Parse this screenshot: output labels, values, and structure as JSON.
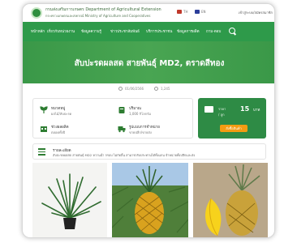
{
  "header": {
    "department_name": "กรมส่งเสริมการเกษตร Department of Agricultural Extension",
    "department_sub": "กระทรวงเกษตรและสหกรณ์ Ministry of Agriculture and Cooperatives",
    "lang_th": "TH",
    "lang_en": "EN",
    "login_label": "เข้าสู่ระบบ/สมัครสมาชิก"
  },
  "nav": {
    "items": [
      "หน้าหลัก",
      "เกี่ยวกับหน่วยงาน",
      "ข้อมูลความรู้",
      "ข่าวประชาสัมพันธ์",
      "บริการประชาชน",
      "ข้อมูลการผลิต",
      "ถาม-ตอบ"
    ]
  },
  "hero": {
    "title": "สับปะรดผลสด สายพันธุ์ MD2, ตราดสีทอง"
  },
  "meta": {
    "date": "01/06/2566",
    "views": "1,245"
  },
  "info": {
    "category_label": "หมวดหมู่",
    "category_value": "ผลไม้/สับปะรด",
    "stock_label": "ปริมาณ",
    "stock_value": "1,000 กิโลกรัม",
    "season_label": "ช่วงผลผลิต",
    "season_value": "ตลอดทั้งปี",
    "delivery_label": "รูปแบบการจำหน่าย",
    "delivery_value": "ขายปลีก/ขายส่ง"
  },
  "price": {
    "label": "ราคา",
    "unit": "/ ลูก",
    "value": "15",
    "currency": "บาท",
    "order_label": "สั่งซื้อสินค้า"
  },
  "description": {
    "title": "รายละเอียด",
    "text": "สับปะรดผลสด สายพันธุ์ MD2 หวานฉ่ำ กรอบ ไม่กัดลิ้น สามารถรับประทานได้ทั้งแกน จำหน่ายทั้งปลีกและส่ง"
  },
  "colors": {
    "brand_green": "#2e9a4a",
    "accent_orange": "#f39c12"
  },
  "icons": [
    "home-logo-icon",
    "search-icon",
    "plant-icon",
    "box-icon",
    "calendar-icon",
    "truck-icon",
    "money-icon",
    "list-icon"
  ]
}
